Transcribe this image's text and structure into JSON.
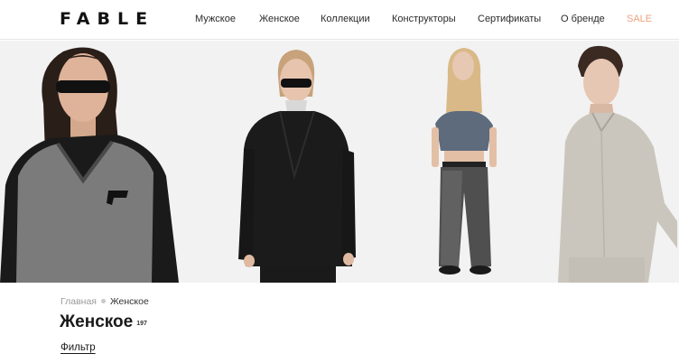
{
  "header": {
    "logo": "FABLE",
    "nav": [
      {
        "label": "Мужское"
      },
      {
        "label": "Женское"
      },
      {
        "label": "Коллекции"
      },
      {
        "label": "Конструкторы"
      },
      {
        "label": "Сертификаты"
      },
      {
        "label": "О бренде"
      },
      {
        "label": "SALE"
      }
    ]
  },
  "breadcrumb": {
    "home": "Главная",
    "current": "Женское"
  },
  "page": {
    "title": "Женское",
    "count": "197"
  },
  "filter": {
    "label": "Фильтр"
  },
  "colors": {
    "sale": "#f0a27c",
    "hero_bg": "#f2f2f2"
  }
}
